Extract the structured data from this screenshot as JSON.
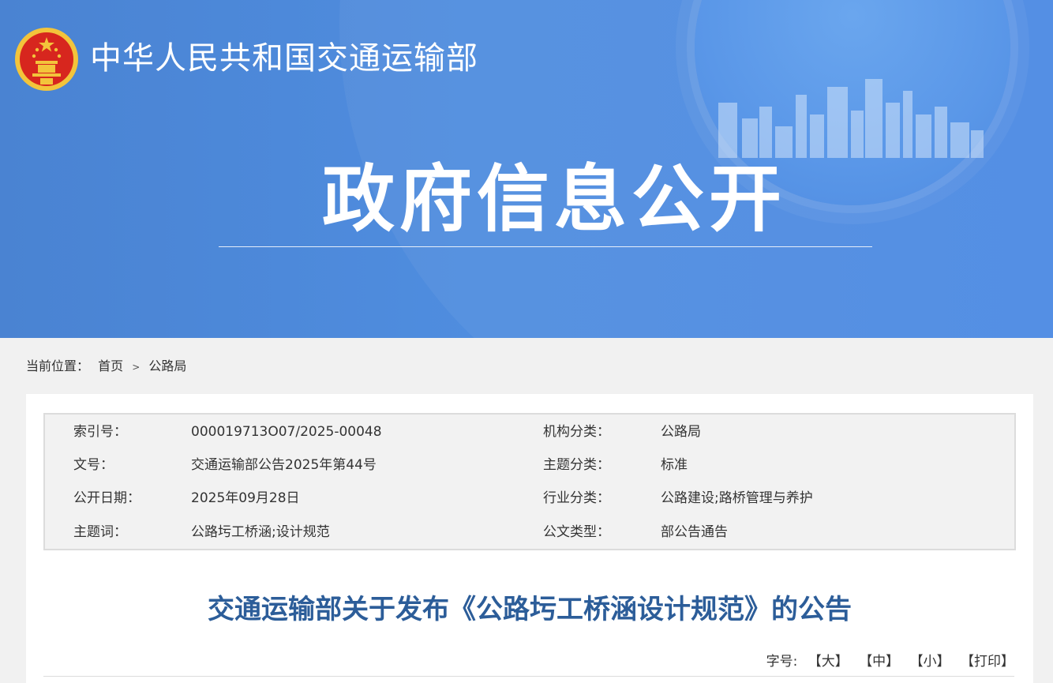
{
  "header": {
    "ministry_name": "中华人民共和国交通运输部",
    "banner_title": "政府信息公开"
  },
  "breadcrumb": {
    "prefix": "当前位置：",
    "items": [
      "首页",
      "公路局"
    ],
    "separator": ">"
  },
  "info": {
    "rows": [
      {
        "left_label": "索引号：",
        "left_value": "000019713O07/2025-00048",
        "right_label": "机构分类：",
        "right_value": "公路局"
      },
      {
        "left_label": "文号：",
        "left_value": "交通运输部公告2025年第44号",
        "right_label": "主题分类：",
        "right_value": "标准"
      },
      {
        "left_label": "公开日期：",
        "left_value": "2025年09月28日",
        "right_label": "行业分类：",
        "right_value": "公路建设;路桥管理与养护"
      },
      {
        "left_label": "主题词：",
        "left_value": "公路圬工桥涵;设计规范",
        "right_label": "公文类型：",
        "right_value": "部公告通告"
      }
    ]
  },
  "article": {
    "title": "交通运输部关于发布《公路圬工桥涵设计规范》的公告"
  },
  "font_tools": {
    "label": "字号:",
    "large": "【大】",
    "medium": "【中】",
    "small": "【小】",
    "print": "【打印】"
  },
  "colors": {
    "banner_blue": "#4f8ddf",
    "title_blue": "#2c5d99",
    "emblem_red": "#d7261e",
    "emblem_gold": "#f3c43b"
  }
}
